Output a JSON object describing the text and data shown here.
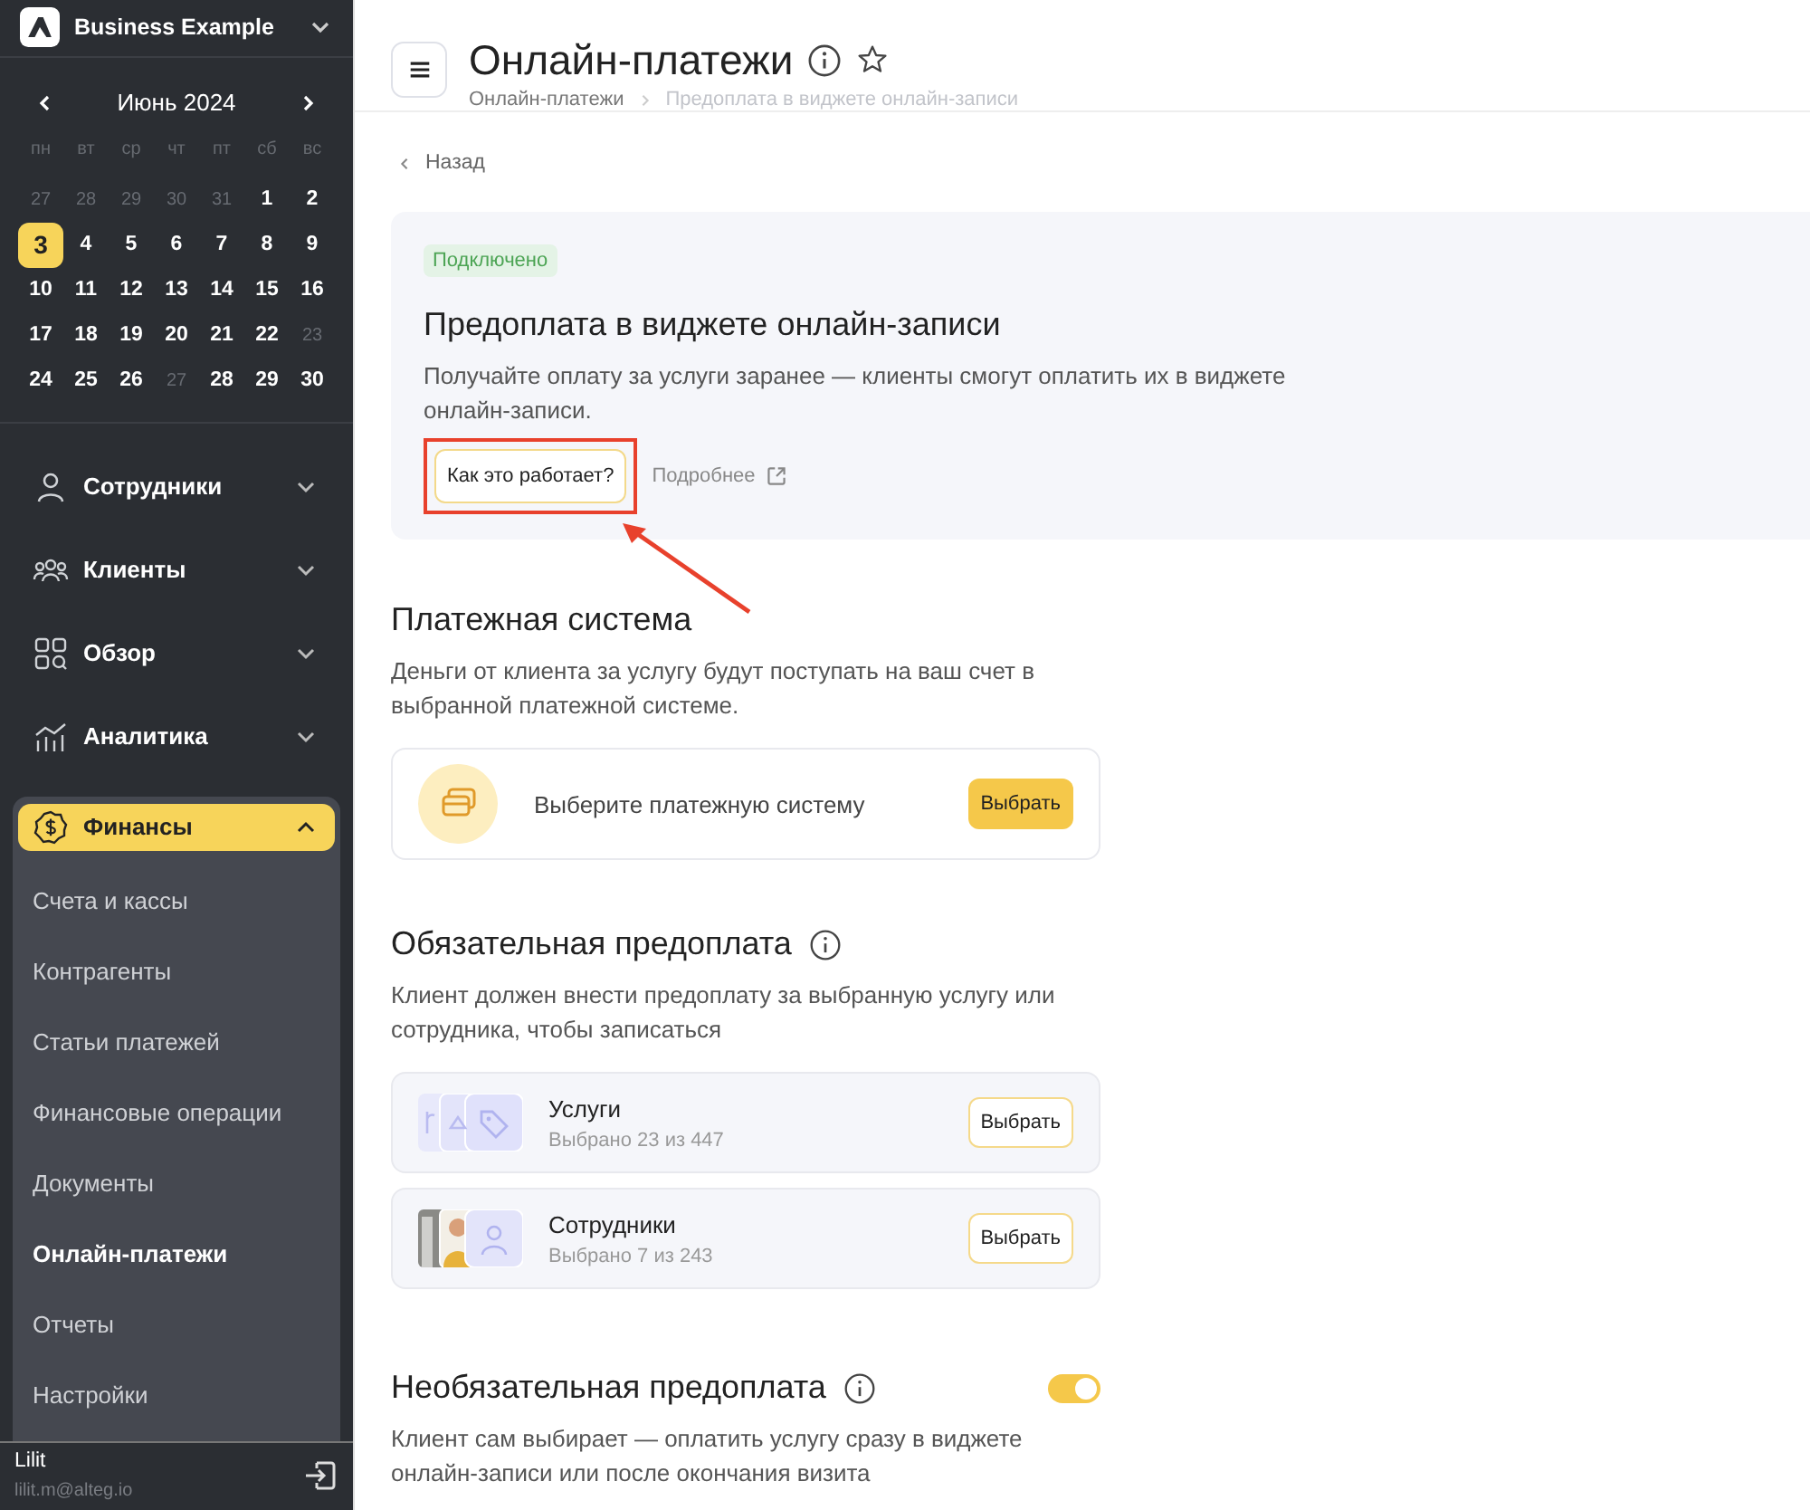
{
  "sidebar": {
    "company": "Business Example",
    "calendar": {
      "month": "Июнь 2024",
      "weekdays": [
        "пн",
        "вт",
        "ср",
        "чт",
        "пт",
        "сб",
        "вс"
      ],
      "days": [
        {
          "day": "27",
          "muted": true,
          "selected": false
        },
        {
          "day": "28",
          "muted": true,
          "selected": false
        },
        {
          "day": "29",
          "muted": true,
          "selected": false
        },
        {
          "day": "30",
          "muted": true,
          "selected": false
        },
        {
          "day": "31",
          "muted": true,
          "selected": false
        },
        {
          "day": "1",
          "muted": false,
          "selected": false
        },
        {
          "day": "2",
          "muted": false,
          "selected": false
        },
        {
          "day": "3",
          "muted": false,
          "selected": true
        },
        {
          "day": "4",
          "muted": false,
          "selected": false
        },
        {
          "day": "5",
          "muted": false,
          "selected": false
        },
        {
          "day": "6",
          "muted": false,
          "selected": false
        },
        {
          "day": "7",
          "muted": false,
          "selected": false
        },
        {
          "day": "8",
          "muted": false,
          "selected": false
        },
        {
          "day": "9",
          "muted": false,
          "selected": false
        },
        {
          "day": "10",
          "muted": false,
          "selected": false
        },
        {
          "day": "11",
          "muted": false,
          "selected": false
        },
        {
          "day": "12",
          "muted": false,
          "selected": false
        },
        {
          "day": "13",
          "muted": false,
          "selected": false
        },
        {
          "day": "14",
          "muted": false,
          "selected": false
        },
        {
          "day": "15",
          "muted": false,
          "selected": false
        },
        {
          "day": "16",
          "muted": false,
          "selected": false
        },
        {
          "day": "17",
          "muted": false,
          "selected": false
        },
        {
          "day": "18",
          "muted": false,
          "selected": false
        },
        {
          "day": "19",
          "muted": false,
          "selected": false
        },
        {
          "day": "20",
          "muted": false,
          "selected": false
        },
        {
          "day": "21",
          "muted": false,
          "selected": false
        },
        {
          "day": "22",
          "muted": false,
          "selected": false
        },
        {
          "day": "23",
          "muted": true,
          "selected": false
        },
        {
          "day": "24",
          "muted": false,
          "selected": false
        },
        {
          "day": "25",
          "muted": false,
          "selected": false
        },
        {
          "day": "26",
          "muted": false,
          "selected": false
        },
        {
          "day": "27",
          "muted": true,
          "selected": false
        },
        {
          "day": "28",
          "muted": false,
          "selected": false
        },
        {
          "day": "29",
          "muted": false,
          "selected": false
        },
        {
          "day": "30",
          "muted": false,
          "selected": false
        }
      ]
    },
    "items": [
      {
        "label": "Сотрудники",
        "kind": "person",
        "expanded": false,
        "selected": false
      },
      {
        "label": "Клиенты",
        "kind": "people",
        "expanded": false,
        "selected": false
      },
      {
        "label": "Обзор",
        "kind": "grid",
        "expanded": false,
        "selected": false
      },
      {
        "label": "Аналитика",
        "kind": "chart",
        "expanded": false,
        "selected": false
      },
      {
        "label": "Финансы",
        "kind": "coin",
        "expanded": true,
        "selected": true,
        "children": [
          {
            "label": "Счета и кассы",
            "selected": false
          },
          {
            "label": "Контрагенты",
            "selected": false
          },
          {
            "label": "Статьи платежей",
            "selected": false
          },
          {
            "label": "Финансовые операции",
            "selected": false
          },
          {
            "label": "Документы",
            "selected": false
          },
          {
            "label": "Онлайн-платежи",
            "selected": true
          },
          {
            "label": "Отчеты",
            "selected": false
          },
          {
            "label": "Настройки",
            "selected": false
          }
        ]
      }
    ],
    "user": {
      "name": "Lilit",
      "email": "lilit.m@alteg.io"
    }
  },
  "header": {
    "title": "Онлайн-платежи",
    "breadcrumbs": [
      "Онлайн-платежи",
      "Предоплата в виджете онлайн-записи"
    ]
  },
  "back": "Назад",
  "intro": {
    "status": "Подключено",
    "title": "Предоплата в виджете онлайн-записи",
    "text": "Получайте оплату за услуги заранее — клиенты смогут оплатить их в виджете онлайн-записи.",
    "button": {
      "label": "Как это работает?",
      "highlighted": true
    },
    "link": "Подробнее"
  },
  "payment_system": {
    "title": "Платежная система",
    "text": "Деньги от клиента за услугу будут поступать на ваш счет в выбранной платежной системе.",
    "placeholder": "Выберите платежную систему",
    "button": "Выбрать"
  },
  "mandatory": {
    "title": "Обязательная предоплата",
    "text": "Клиент должен внести предоплату за выбранную услугу или сотрудника, чтобы записаться",
    "rows": [
      {
        "kind": "services",
        "title": "Услуги",
        "count": "Выбрано 23 из 447",
        "button": "Выбрать"
      },
      {
        "kind": "staff",
        "title": "Сотрудники",
        "count": "Выбрано 7 из 243",
        "button": "Выбрать"
      }
    ]
  },
  "optional": {
    "title": "Необязательная предоплата",
    "on": true,
    "text": "Клиент сам выбирает — оплатить услугу сразу в виджете онлайн-записи или после окончания визита"
  }
}
